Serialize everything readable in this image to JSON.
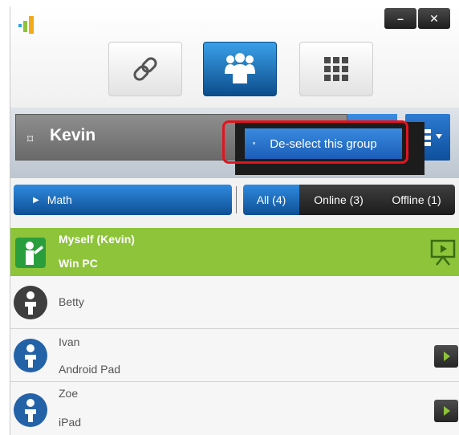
{
  "window": {
    "minimize_label": "–",
    "close_label": "✕"
  },
  "modes": [
    {
      "name": "link",
      "icon": "link-icon",
      "active": false
    },
    {
      "name": "users",
      "icon": "users-group-icon",
      "active": true
    },
    {
      "name": "grid",
      "icon": "grid-icon",
      "active": false
    }
  ],
  "user": {
    "name": "Kevin",
    "icon": "pin-icon"
  },
  "context_menu": {
    "item_label": "De-select this group"
  },
  "filter": {
    "group_label": "Math",
    "tabs": [
      {
        "label": "All (4)",
        "active": true
      },
      {
        "label": "Online (3)",
        "active": false
      },
      {
        "label": "Offline (1)",
        "active": false
      }
    ]
  },
  "students": [
    {
      "name": "Myself (Kevin)",
      "device": "Win PC",
      "status": "self"
    },
    {
      "name": "Betty",
      "device": "",
      "status": "offline"
    },
    {
      "name": "Ivan",
      "device": "Android Pad",
      "status": "online"
    },
    {
      "name": "Zoe",
      "device": "iPad",
      "status": "online"
    }
  ],
  "colors": {
    "accent_blue": "#1b5db8",
    "self_row_green": "#8dc43a",
    "highlight_red": "#e2141f"
  }
}
